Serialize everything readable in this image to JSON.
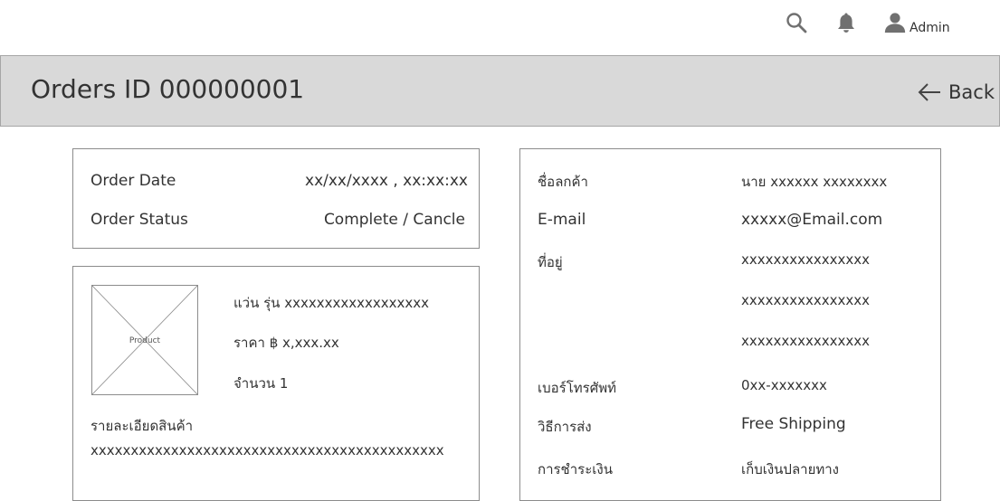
{
  "header": {
    "admin_label": "Admin",
    "title": "Orders ID 000000001",
    "back_label": "Back"
  },
  "order_info": {
    "rows": [
      {
        "label": "Order Date",
        "value": "xx/xx/xxxx , xx:xx:xx"
      },
      {
        "label": "Order Status",
        "value": "Complete / Cancle"
      }
    ]
  },
  "product": {
    "image_label": "Product",
    "name": "แว่น รุ่น xxxxxxxxxxxxxxxxxx",
    "price": "ราคา ฿ x,xxx.xx",
    "quantity": "จำนวน 1",
    "details_label": "รายละเอียดสินค้า",
    "details_value": "xxxxxxxxxxxxxxxxxxxxxxxxxxxxxxxxxxxxxxxxxxxx"
  },
  "customer": {
    "name_label": "ชื่อลกค้า",
    "name_value": "นาย xxxxxx  xxxxxxxx",
    "email_label": "E-mail",
    "email_value": "xxxxx@Email.com",
    "address_label": "ที่อยู่",
    "address_lines": [
      "xxxxxxxxxxxxxxxx",
      "xxxxxxxxxxxxxxxx",
      "xxxxxxxxxxxxxxxx"
    ],
    "phone_label": "เบอร์โทรศัพท์",
    "phone_value": "0xx-xxxxxxx",
    "shipping_label": "วิธีการส่ง",
    "shipping_value": "Free Shipping",
    "payment_label": "การชำระเงิน",
    "payment_value": "เก็บเงินปลายทาง"
  },
  "icons": {
    "search": "search-icon",
    "bell": "bell-icon",
    "user": "user-icon",
    "back": "arrow-left-icon"
  }
}
